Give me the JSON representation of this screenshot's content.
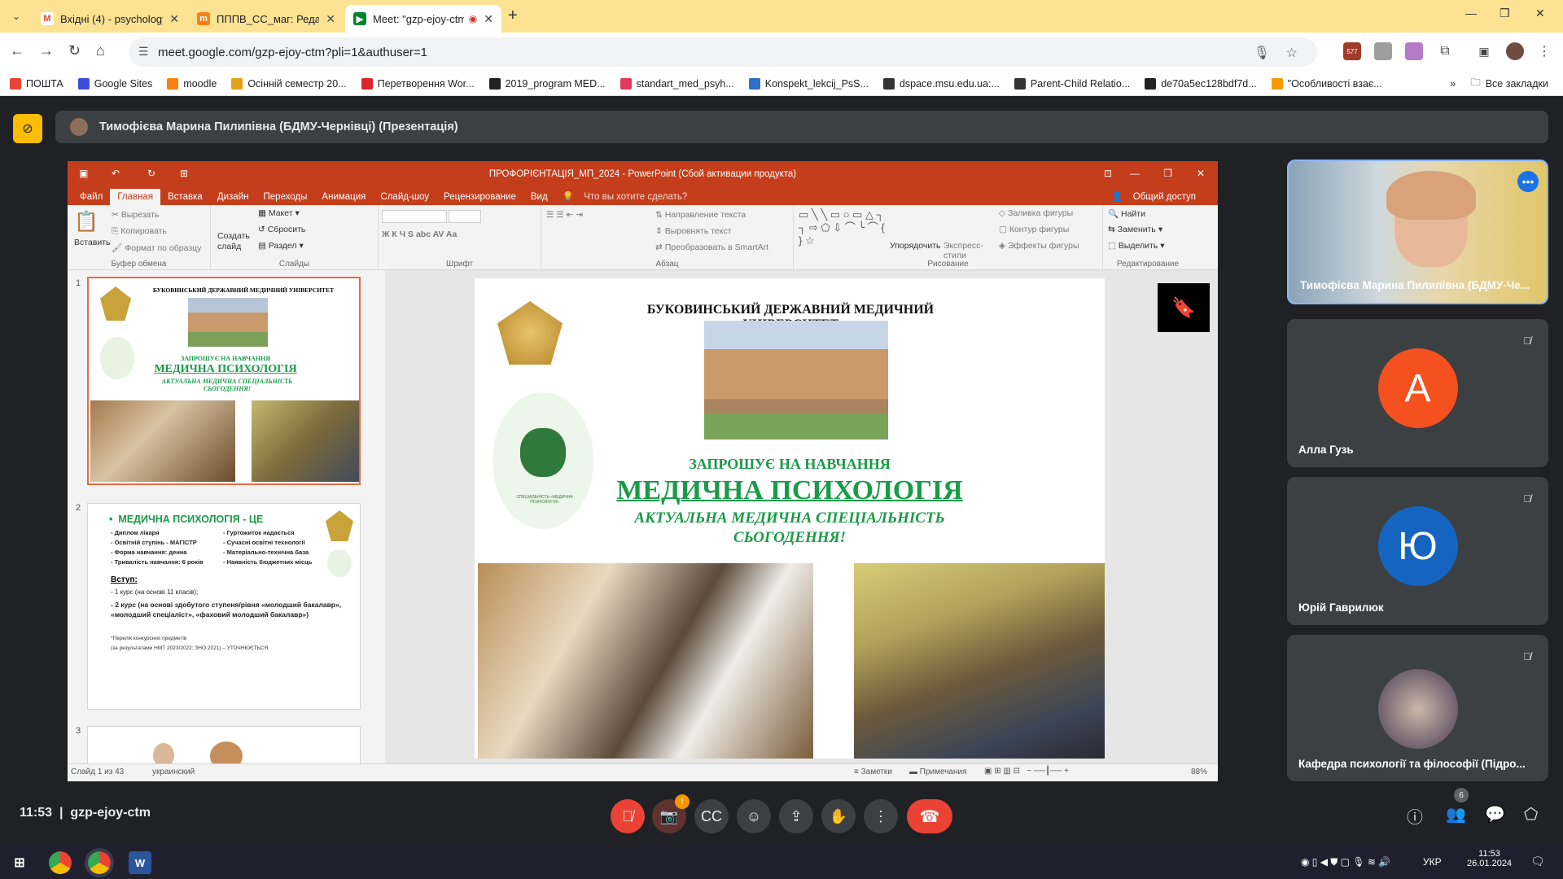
{
  "tabs": [
    {
      "title": "Вхідні (4) - psychology@bsmu.edu.ua",
      "icon": "gmail-icon"
    },
    {
      "title": "ПППВ_СС_маг: Редагування",
      "icon": "moodle-icon"
    },
    {
      "title": "Meet: \"gzp-ejoy-ctm\"",
      "icon": "meet-icon"
    }
  ],
  "address": {
    "url": "meet.google.com/gzp-ejoy-ctm?pli=1&authuser=1"
  },
  "extension_badge": "577",
  "bookmarks": [
    {
      "label": "ПОШТА",
      "color": "#ea4335"
    },
    {
      "label": "Google Sites",
      "color": "#3c4fd6"
    },
    {
      "label": "moodle",
      "color": "#f98012"
    },
    {
      "label": "Осінній семестр 20...",
      "color": "#e4a11b"
    },
    {
      "label": "Перетворення Wor...",
      "color": "#d9262b"
    },
    {
      "label": "2019_program MED...",
      "color": "#222222"
    },
    {
      "label": "standart_med_psyh...",
      "color": "#e03a5c"
    },
    {
      "label": "Konspekt_lekcij_PsS...",
      "color": "#2f6fc4"
    },
    {
      "label": "dspace.msu.edu.ua:...",
      "color": "#333333"
    },
    {
      "label": "Parent-Child Relatio...",
      "color": "#333333"
    },
    {
      "label": "de70a5ec128bdf7d...",
      "color": "#222222"
    },
    {
      "label": "\"Особливості взає...",
      "color": "#f29900"
    }
  ],
  "all_bookmarks": "Все закладки",
  "presenter_bar": {
    "title": "Тимофієва Марина Пилипівна (БДМУ-Чернівці) (Презентація)"
  },
  "ppt": {
    "window_title": "ПРОФОРІЄНТАЦІЯ_МП_2024 - PowerPoint (Сбой активации продукта)",
    "menu": [
      "Файл",
      "Главная",
      "Вставка",
      "Дизайн",
      "Переходы",
      "Анимация",
      "Слайд-шоу",
      "Рецензирование",
      "Вид"
    ],
    "tell_me": "Что вы хотите сделать?",
    "share": "Общий доступ",
    "ribbon": {
      "paste": "Вставить",
      "cut": "Вырезать",
      "copy": "Копировать",
      "format_painter": "Формат по образцу",
      "clipboard": "Буфер обмена",
      "new_slide": "Создать слайд",
      "layout": "Макет",
      "reset": "Сбросить",
      "section": "Раздел",
      "slides": "Слайды",
      "font": "Шрифт",
      "text_dir": "Направление текста",
      "align_text": "Выровнять текст",
      "smartart": "Преобразовать в SmartArt",
      "paragraph": "Абзац",
      "arrange": "Упорядочить",
      "quick_styles": "Экспресс-стили",
      "shape_fill": "Заливка фигуры",
      "shape_outline": "Контур фигуры",
      "shape_effects": "Эффекты фигуры",
      "drawing": "Рисование",
      "find": "Найти",
      "replace": "Заменить",
      "select": "Выделить",
      "editing": "Редактирование"
    },
    "thumb1": {
      "uni": "БУКОВИНСЬКИЙ ДЕРЖАВНИЙ МЕДИЧНИЙ УНІВЕРСИТЕТ",
      "invite": "ЗАПРОШУЄ НА НАВЧАННЯ",
      "title": "МЕДИЧНА ПСИХОЛОГІЯ",
      "sub": "АКТУАЛЬНА МЕДИЧНА СПЕЦІАЛЬНІСТЬ СЬОГОДЕННЯ!"
    },
    "thumb2": {
      "title": "МЕДИЧНА ПСИХОЛОГІЯ - ЦЕ",
      "col1": [
        "- Диплом лікаря",
        "- Освітній ступінь - МАГІСТР",
        "- Форма навчання: денна",
        "- Тривалість навчання: 6 років"
      ],
      "col2": [
        "- Гуртожиток надається",
        "- Сучасні освітні технології",
        "- Матеріально-технічна база",
        "- Наявність бюджетних місць"
      ],
      "entry": "Вступ:",
      "entry1": "- 1 курс (на основі 11 класів);",
      "entry2": "- 2 курс (на основі здобутого ступеня/рівня «молодший бакалавр», «молодший спеціаліст», «фаховий молодший бакалавр»)",
      "note1": "*Перелік конкурсних предметів",
      "note2": "(за результатами НМТ 2023/2022; ЗНО 2021) – УТОЧНЮЄТЬСЯ"
    },
    "slide": {
      "uni": "БУКОВИНСЬКИЙ ДЕРЖАВНИЙ  МЕДИЧНИЙ УНІВЕРСИТЕТ",
      "invite": "ЗАПРОШУЄ НА НАВЧАННЯ",
      "title": "МЕДИЧНА ПСИХОЛОГІЯ",
      "sub1": "АКТУАЛЬНА МЕДИЧНА СПЕЦІАЛЬНІСТЬ",
      "sub2": "СЬОГОДЕННЯ!",
      "logo_text": "СПЕЦІАЛЬНІСТЬ «МЕДИЧНА ПСИХОЛОГІЯ»"
    },
    "status": {
      "slide": "Слайд 1 из 43",
      "lang": "украинский",
      "notes": "Заметки",
      "comments": "Примечания",
      "zoom": "88%"
    }
  },
  "participants": [
    {
      "name": "Тимофієва Марина Пилипівна (БДМУ-Че...",
      "type": "video"
    },
    {
      "name": "Алла Гузь",
      "initial": "А",
      "color": "#f4511e"
    },
    {
      "name": "Юрій Гаврилюк",
      "initial": "Ю",
      "color": "#1565c0"
    },
    {
      "name": "Кафедра психології та філософії (Підро...",
      "type": "photo"
    }
  ],
  "meet_bottom": {
    "time": "11:53",
    "code": "gzp-ejoy-ctm",
    "people_count": "6",
    "camera_alert": "!"
  },
  "taskbar": {
    "lang": "УКР",
    "time": "11:53",
    "date": "26.01.2024"
  }
}
